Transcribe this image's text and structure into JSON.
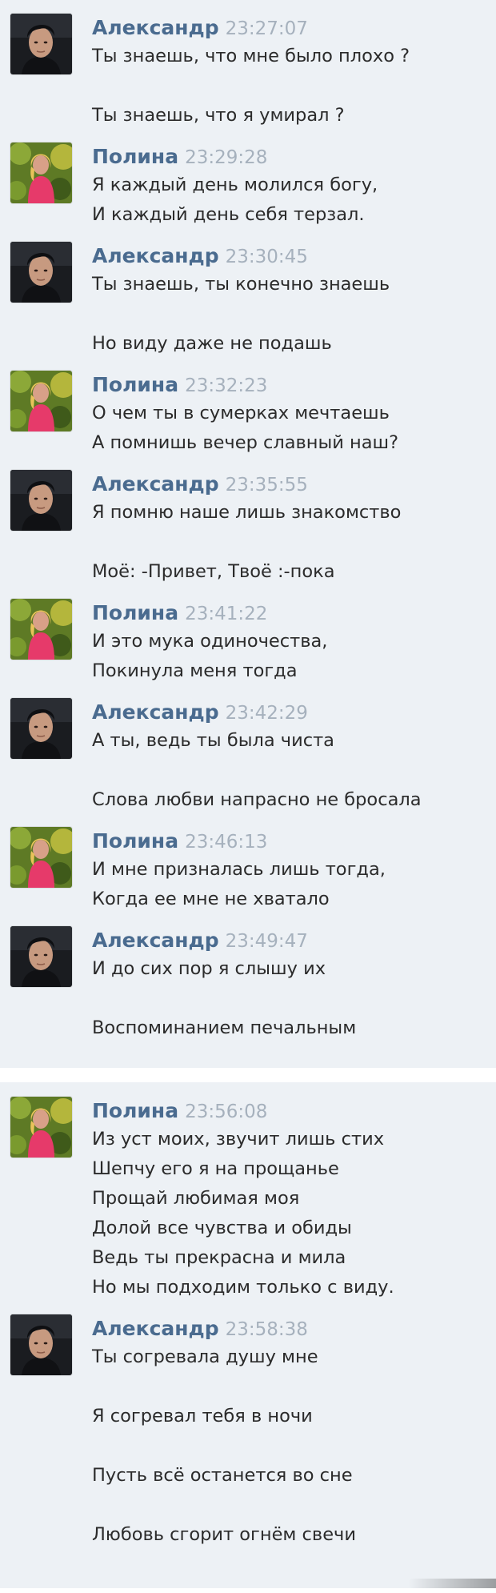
{
  "messages": [
    {
      "author": "Александр",
      "avatar": "male-avatar-icon",
      "time": "23:27:07",
      "lines": [
        "Ты знаешь, что мне было плохо ?",
        "Ты знаешь, что я умирал ?"
      ]
    },
    {
      "author": "Полина",
      "avatar": "female-avatar-icon",
      "time": "23:29:28",
      "lines": [
        "Я каждый день молился богу,",
        "И каждый день себя терзал."
      ]
    },
    {
      "author": "Александр",
      "avatar": "male-avatar-icon",
      "time": "23:30:45",
      "lines": [
        "Ты знаешь, ты конечно знаешь",
        "Но виду даже не подашь"
      ]
    },
    {
      "author": "Полина",
      "avatar": "female-avatar-icon",
      "time": "23:32:23",
      "lines": [
        "О чем ты в сумерках мечтаешь",
        "А помнишь вечер славный наш?"
      ]
    },
    {
      "author": "Александр",
      "avatar": "male-avatar-icon",
      "time": "23:35:55",
      "lines": [
        "Я помню наше лишь знакомство",
        "Моё: -Привет, Твоё :-пока"
      ]
    },
    {
      "author": "Полина",
      "avatar": "female-avatar-icon",
      "time": "23:41:22",
      "lines": [
        "И это мука одиночества,",
        "Покинула меня тогда"
      ]
    },
    {
      "author": "Александр",
      "avatar": "male-avatar-icon",
      "time": "23:42:29",
      "lines": [
        "А ты, ведь ты была чиста",
        "Слова любви напрасно не бросала"
      ]
    },
    {
      "author": "Полина",
      "avatar": "female-avatar-icon",
      "time": "23:46:13",
      "lines": [
        "И мне призналась лишь тогда,",
        "Когда ее мне не хватало"
      ]
    },
    {
      "author": "Александр",
      "avatar": "male-avatar-icon",
      "time": "23:49:47",
      "lines": [
        "И до сих пор я слышу их",
        "Воспоминанием печальным"
      ]
    },
    {
      "author": "Полина",
      "avatar": "female-avatar-icon",
      "time": "23:56:08",
      "lines": [
        "Из уст моих, звучит лишь стих",
        "Шепчу его я на прощанье",
        "Прощай любимая моя",
        "Долой все чувства и обиды",
        "Ведь ты прекрасна и мила",
        "Но мы подходим только с виду."
      ]
    },
    {
      "author": "Александр",
      "avatar": "male-avatar-icon",
      "time": "23:58:38",
      "lines": [
        "Ты согревала душу мне",
        "Я согревал тебя в ночи",
        "Пусть всё останется во сне",
        "Любовь сгорит огнём свечи"
      ]
    }
  ],
  "colors": {
    "background": "#edf1f5",
    "author": "#4a6b8f",
    "time": "#a6b1bd",
    "text": "#2b2b2b"
  }
}
